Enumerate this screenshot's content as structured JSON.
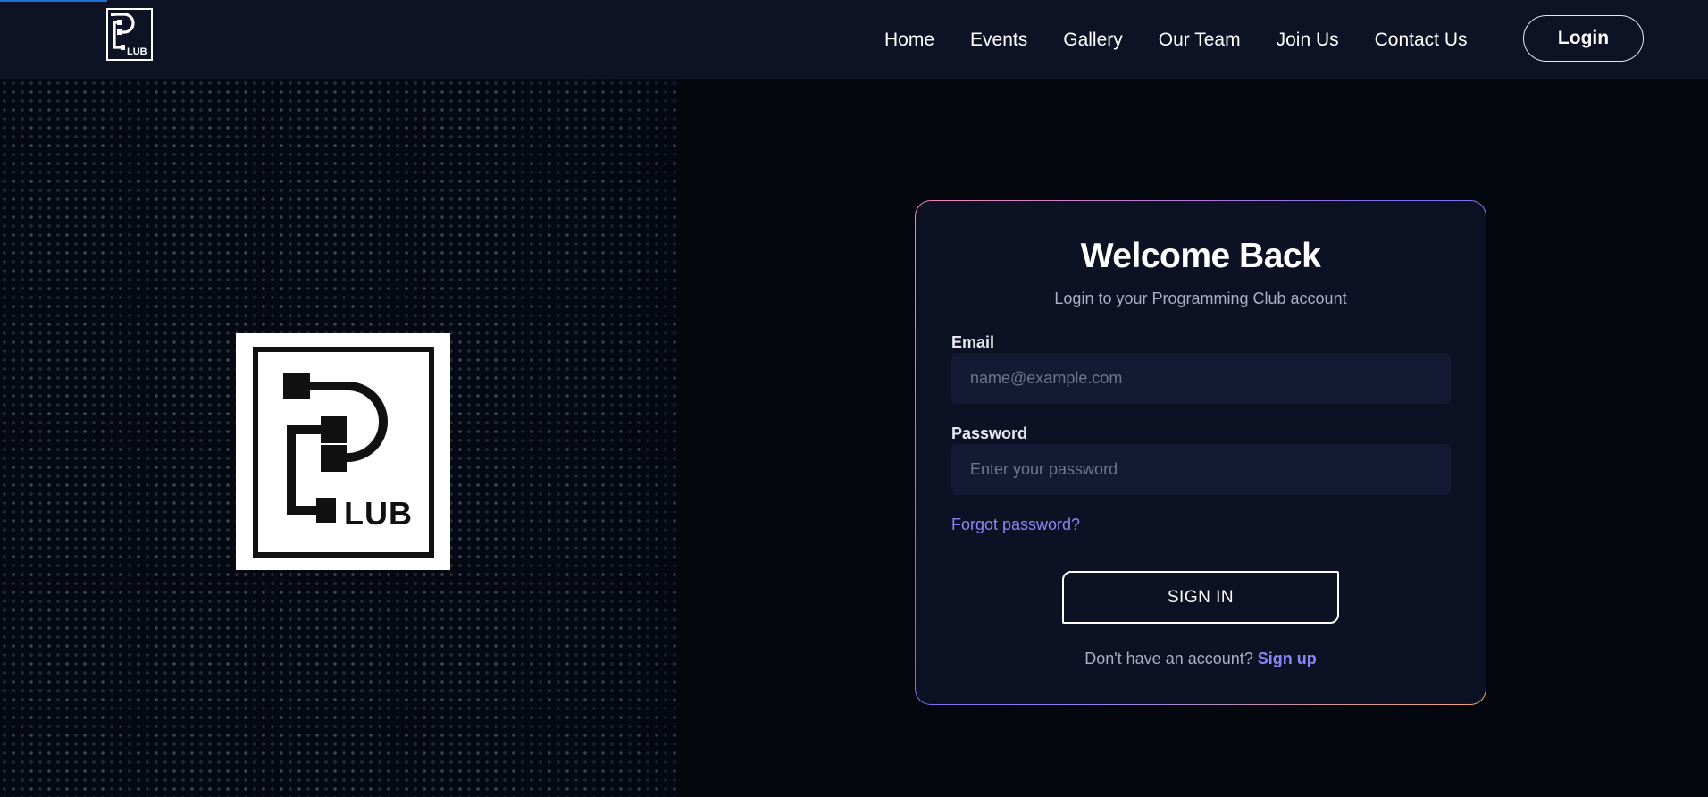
{
  "nav": {
    "logo_text": "LUB",
    "links": [
      {
        "label": "Home"
      },
      {
        "label": "Events"
      },
      {
        "label": "Gallery"
      },
      {
        "label": "Our Team"
      },
      {
        "label": "Join Us"
      },
      {
        "label": "Contact Us"
      }
    ],
    "login_label": "Login"
  },
  "hero": {
    "logo_text": "LUB",
    "logo_icon": "pc-club-logo"
  },
  "login_card": {
    "title": "Welcome Back",
    "subtitle": "Login to your Programming Club account",
    "email": {
      "label": "Email",
      "value": "",
      "placeholder": "name@example.com"
    },
    "password": {
      "label": "Password",
      "value": "",
      "placeholder": "Enter your password"
    },
    "forgot_password": "Forgot password?",
    "submit_label": "SIGN IN",
    "signup_prompt": "Don't have an account?",
    "signup_link": "Sign up"
  },
  "colors": {
    "navbar_bg": "#0d1224",
    "page_bg": "#05070f",
    "card_bg": "#0c1123",
    "input_bg": "#141a33",
    "link_accent": "#8a86f5",
    "card_border_gradient": [
      "#f28ab4",
      "#7c6cf0",
      "#f6a66a"
    ]
  }
}
